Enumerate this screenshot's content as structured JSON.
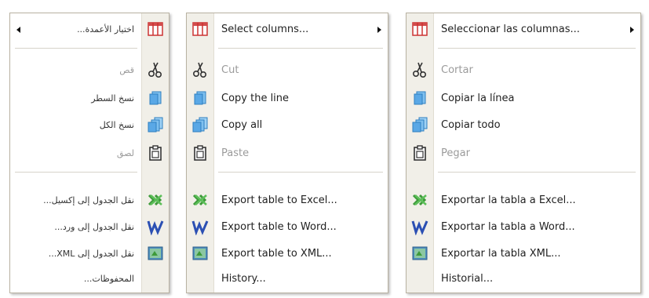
{
  "menus": {
    "arabic": {
      "items": {
        "select_columns": "اختيار الأعمدة...",
        "cut": "قص",
        "copy_line": "نسخ السطر",
        "copy_all": "نسخ الكل",
        "paste": "لصق",
        "export_excel": "نقل الجدول إلى إكسيل...",
        "export_word": "نقل الجدول إلى ورد...",
        "export_xml": "نقل الجدول إلى XML...",
        "history": "المحفوظات..."
      }
    },
    "english": {
      "items": {
        "select_columns": "Select columns...",
        "cut": "Cut",
        "copy_line": "Copy the line",
        "copy_all": "Copy all",
        "paste": "Paste",
        "export_excel": "Export table to Excel...",
        "export_word": "Export table to Word...",
        "export_xml": "Export table to XML...",
        "history": "History..."
      }
    },
    "spanish": {
      "items": {
        "select_columns": "Seleccionar las columnas...",
        "cut": "Cortar",
        "copy_line": "Copiar la línea",
        "copy_all": "Copiar todo",
        "paste": "Pegar",
        "export_excel": "Exportar la tabla a Excel...",
        "export_word": "Exportar la tabla a Word...",
        "export_xml": "Exportar la tabla XML...",
        "history": "Historial..."
      }
    }
  },
  "icons": {
    "select_columns": "columns-icon",
    "cut": "scissors-icon",
    "copy_line": "copy-line-icon",
    "copy_all": "copy-all-icon",
    "paste": "clipboard-icon",
    "export_excel": "excel-icon",
    "export_word": "word-icon",
    "export_xml": "xml-icon"
  },
  "colors": {
    "strip": "#f1efe8",
    "border": "#b9b2a2",
    "disabled_text": "#9b9b9b",
    "columns_red": "#d24b4b",
    "copy_blue": "#3d8fd6",
    "excel_green": "#3e9a3a",
    "word_blue": "#2b4fb3"
  }
}
